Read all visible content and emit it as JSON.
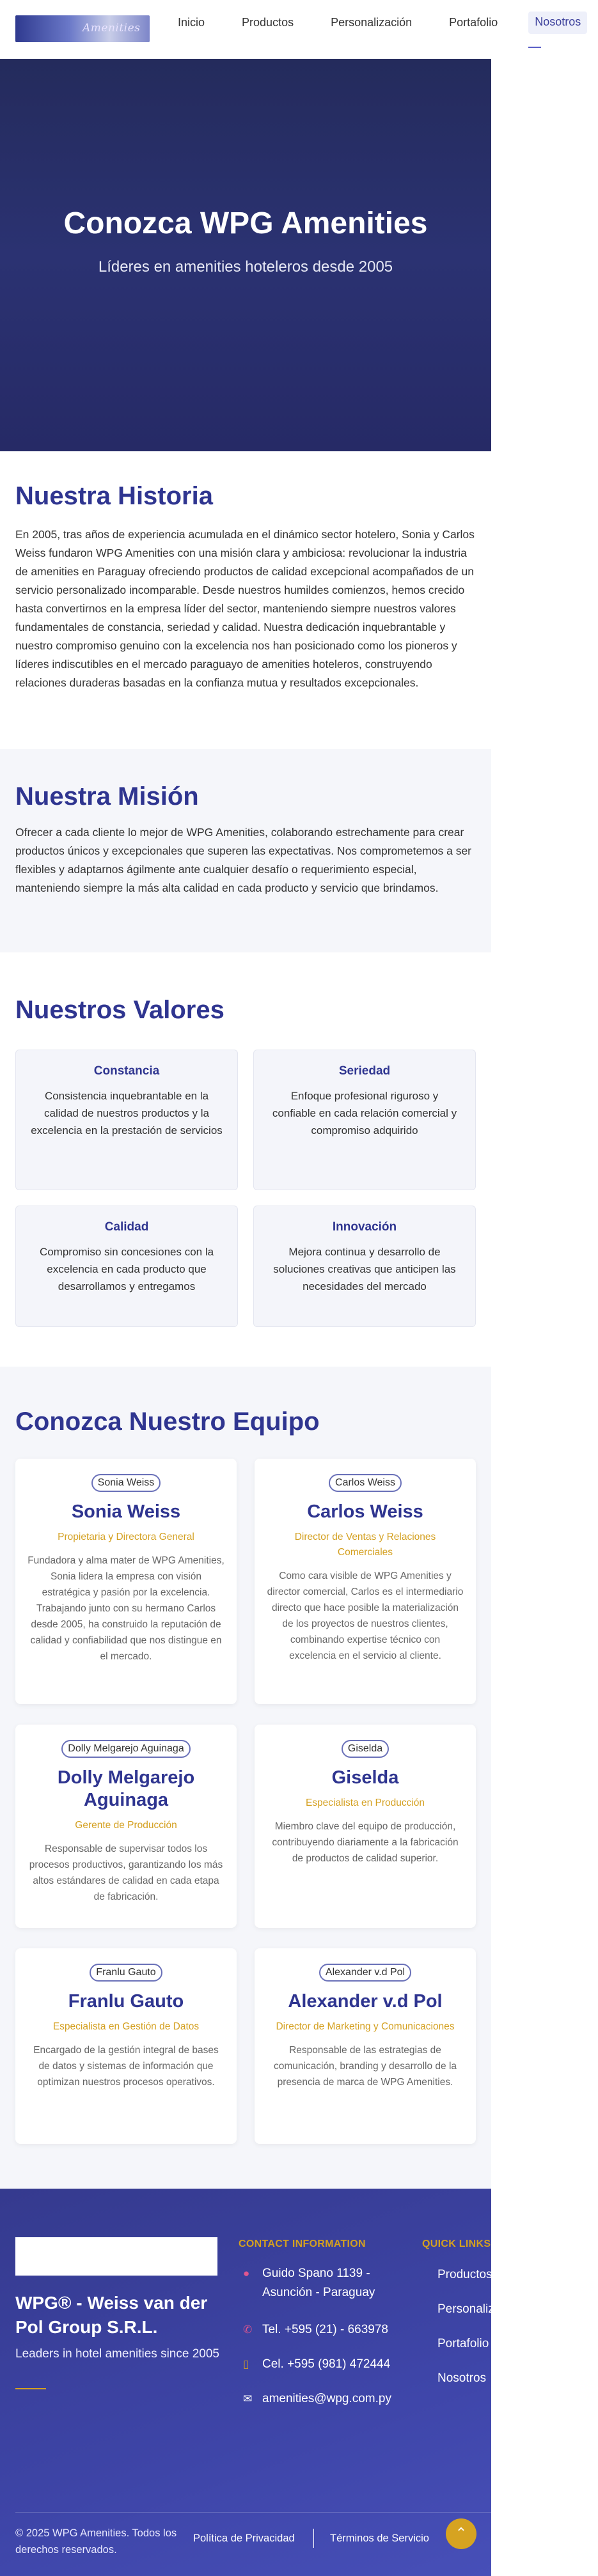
{
  "nav": {
    "logo_text": "Amenities",
    "links": [
      "Inicio",
      "Productos",
      "Personalización",
      "Portafolio",
      "Nosotros"
    ]
  },
  "hero": {
    "title": "Conozca WPG Amenities",
    "subtitle": "Líderes en amenities hoteleros desde 2005"
  },
  "historia": {
    "title": "Nuestra Historia",
    "text": "En 2005, tras años de experiencia acumulada en el dinámico sector hotelero, Sonia y Carlos Weiss fundaron WPG Amenities con una misión clara y ambiciosa: revolucionar la industria de amenities en Paraguay ofreciendo productos de calidad excepcional acompañados de un servicio personalizado incomparable. Desde nuestros humildes comienzos, hemos crecido hasta convertirnos en la empresa líder del sector, manteniendo siempre nuestros valores fundamentales de constancia, seriedad y calidad. Nuestra dedicación inquebrantable y nuestro compromiso genuino con la excelencia nos han posicionado como los pioneros y líderes indiscutibles en el mercado paraguayo de amenities hoteleros, construyendo relaciones duraderas basadas en la confianza mutua y resultados excepcionales."
  },
  "mision": {
    "title": "Nuestra Misión",
    "text": "Ofrecer a cada cliente lo mejor de WPG Amenities, colaborando estrechamente para crear productos únicos y excepcionales que superen las expectativas. Nos comprometemos a ser flexibles y adaptarnos ágilmente ante cualquier desafío o requerimiento especial, manteniendo siempre la más alta calidad en cada producto y servicio que brindamos."
  },
  "valores": {
    "title": "Nuestros Valores",
    "items": [
      {
        "title": "Constancia",
        "text": "Consistencia inquebrantable en la calidad de nuestros productos y la excelencia en la prestación de servicios"
      },
      {
        "title": "Seriedad",
        "text": "Enfoque profesional riguroso y confiable en cada relación comercial y compromiso adquirido"
      },
      {
        "title": "Calidad",
        "text": "Compromiso sin concesiones con la excelencia en cada producto que desarrollamos y entregamos"
      },
      {
        "title": "Innovación",
        "text": "Mejora continua y desarrollo de soluciones creativas que anticipen las necesidades del mercado"
      }
    ]
  },
  "equipo": {
    "title": "Conozca Nuestro Equipo",
    "members": [
      {
        "img_alt": "Sonia Weiss",
        "name": "Sonia Weiss",
        "role": "Propietaria y Directora General",
        "bio": "Fundadora y alma mater de WPG Amenities, Sonia lidera la empresa con visión estratégica y pasión por la excelencia. Trabajando junto con su hermano Carlos desde 2005, ha construido la reputación de calidad y confiabilidad que nos distingue en el mercado."
      },
      {
        "img_alt": "Carlos Weiss",
        "name": "Carlos Weiss",
        "role": "Director de Ventas y Relaciones Comerciales",
        "bio": "Como cara visible de WPG Amenities y director comercial, Carlos es el intermediario directo que hace posible la materialización de los proyectos de nuestros clientes, combinando expertise técnico con excelencia en el servicio al cliente."
      },
      {
        "img_alt": "Dolly Melgarejo Aguinaga",
        "name": "Dolly Melgarejo Aguinaga",
        "role": "Gerente de Producción",
        "bio": "Responsable de supervisar todos los procesos productivos, garantizando los más altos estándares de calidad en cada etapa de fabricación."
      },
      {
        "img_alt": "Giselda",
        "name": "Giselda",
        "role": "Especialista en Producción",
        "bio": "Miembro clave del equipo de producción, contribuyendo diariamente a la fabricación de productos de calidad superior."
      },
      {
        "img_alt": "Franlu Gauto",
        "name": "Franlu Gauto",
        "role": "Especialista en Gestión de Datos",
        "bio": "Encargado de la gestión integral de bases de datos y sistemas de información que optimizan nuestros procesos operativos."
      },
      {
        "img_alt": "Alexander v.d Pol",
        "name": "Alexander v.d Pol",
        "role": "Director de Marketing y Comunicaciones",
        "bio": "Responsable de las estrategias de comunicación, branding y desarrollo de la presencia de marca de WPG Amenities."
      }
    ]
  },
  "footer": {
    "company": "WPG® - Weiss van der Pol Group S.R.L.",
    "tagline": "Leaders in hotel amenities since 2005",
    "contact_heading": "CONTACT INFORMATION",
    "quick_heading": "QUICK LINKS",
    "contacts": [
      {
        "icon": "map-pin-icon",
        "glyph": "📍",
        "text": "Guido Spano 1139 - Asunción - Paraguay"
      },
      {
        "icon": "phone-icon",
        "glyph": "📞",
        "text": "Tel. +595 (21) - 663978"
      },
      {
        "icon": "mobile-icon",
        "glyph": "▯",
        "text": "Cel. +595 (981) 472444"
      },
      {
        "icon": "envelope-icon",
        "glyph": "✉",
        "text": "amenities@wpg.com.py"
      }
    ],
    "quick_links": [
      "Productos",
      "Personalización",
      "Portafolio",
      "Nosotros"
    ],
    "copyright": "© 2025 WPG Amenities. Todos los derechos reservados.",
    "privacy": "Política de Privacidad",
    "terms": "Términos de Servicio"
  },
  "colors": {
    "primary": "#2f3590",
    "accent": "#d4a020",
    "hero_bg": "#262a66",
    "section_alt_bg": "#f5f6fa"
  }
}
